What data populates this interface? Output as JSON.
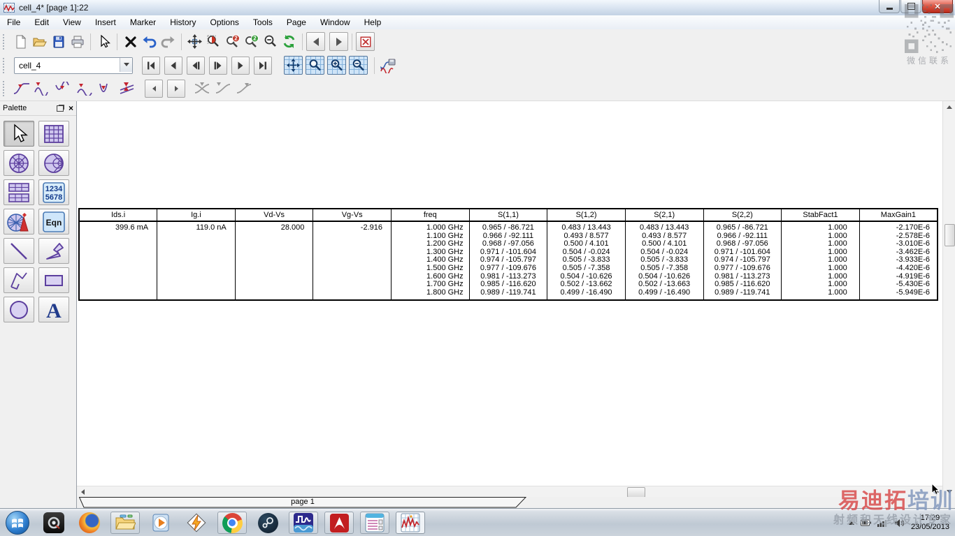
{
  "window": {
    "title": "cell_4* [page 1]:22"
  },
  "menu": {
    "items": [
      "File",
      "Edit",
      "View",
      "Insert",
      "Marker",
      "History",
      "Options",
      "Tools",
      "Page",
      "Window",
      "Help"
    ]
  },
  "toolbars": {
    "standard_icons": [
      "new-document",
      "open-project",
      "save",
      "print",
      "select-pointer",
      "delete",
      "undo",
      "redo",
      "pan-view",
      "zoom-area",
      "zoom-in-2x",
      "zoom-out-2x",
      "zoom-out",
      "refresh",
      "back",
      "forward",
      "close-window"
    ],
    "zoom_badge": "2",
    "page_nav": {
      "scope_value": "cell_4",
      "nav_icons": [
        "first-page",
        "previous-page",
        "step-back",
        "step-forward",
        "next-page",
        "last-page"
      ],
      "view_icons": [
        "view-all",
        "zoom-window",
        "zoom-in",
        "zoom-out"
      ],
      "extra_icons": [
        "add-trace"
      ]
    },
    "marker_icons": [
      "marker-on-trace",
      "marker-peak",
      "marker-valley",
      "marker-offset",
      "marker-search",
      "marker-limit-lines",
      "marker-previous",
      "marker-next",
      "marker-disabled-1",
      "marker-disabled-2",
      "marker-disabled-3"
    ]
  },
  "palette": {
    "title": "Palette",
    "buttons": [
      "pointer",
      "rectangular-graph",
      "polar-graph",
      "smith-chart",
      "tabular-graph",
      "numeric-table",
      "antenna-plot",
      "equation",
      "line",
      "polygon",
      "polyline",
      "rectangle",
      "circle",
      "text"
    ],
    "numeric_line1": "1234",
    "numeric_line2": "5678",
    "equation_label": "Eqn",
    "text_label": "A"
  },
  "table": {
    "columns": [
      {
        "header": "Ids.i",
        "align": "right",
        "values": [
          "399.6 mA"
        ]
      },
      {
        "header": "Ig.i",
        "align": "right",
        "values": [
          "119.0 nA"
        ]
      },
      {
        "header": "Vd-Vs",
        "align": "right",
        "values": [
          "28.000"
        ]
      },
      {
        "header": "Vg-Vs",
        "align": "right",
        "values": [
          "-2.916"
        ]
      },
      {
        "header": "freq",
        "align": "right",
        "values": [
          "1.000 GHz",
          "1.100 GHz",
          "1.200 GHz",
          "1.300 GHz",
          "1.400 GHz",
          "1.500 GHz",
          "1.600 GHz",
          "1.700 GHz",
          "1.800 GHz"
        ]
      },
      {
        "header": "S(1,1)",
        "align": "center",
        "values": [
          "0.965 / -86.721",
          "0.966 / -92.111",
          "0.968 / -97.056",
          "0.971 / -101.604",
          "0.974 / -105.797",
          "0.977 / -109.676",
          "0.981 / -113.273",
          "0.985 / -116.620",
          "0.989 / -119.741"
        ]
      },
      {
        "header": "S(1,2)",
        "align": "center",
        "values": [
          "0.483 / 13.443",
          "0.493 / 8.577",
          "0.500 / 4.101",
          "0.504 / -0.024",
          "0.505 / -3.833",
          "0.505 / -7.358",
          "0.504 / -10.626",
          "0.502 / -13.662",
          "0.499 / -16.490"
        ]
      },
      {
        "header": "S(2,1)",
        "align": "center",
        "values": [
          "0.483 / 13.443",
          "0.493 / 8.577",
          "0.500 / 4.101",
          "0.504 / -0.024",
          "0.505 / -3.833",
          "0.505 / -7.358",
          "0.504 / -10.626",
          "0.502 / -13.663",
          "0.499 / -16.490"
        ]
      },
      {
        "header": "S(2,2)",
        "align": "center",
        "values": [
          "0.965 / -86.721",
          "0.966 / -92.111",
          "0.968 / -97.056",
          "0.971 / -101.604",
          "0.974 / -105.797",
          "0.977 / -109.676",
          "0.981 / -113.273",
          "0.985 / -116.620",
          "0.989 / -119.741"
        ]
      },
      {
        "header": "StabFact1",
        "align": "right",
        "values": [
          "1.000",
          "1.000",
          "1.000",
          "1.000",
          "1.000",
          "1.000",
          "1.000",
          "1.000",
          "1.000"
        ]
      },
      {
        "header": "MaxGain1",
        "align": "right",
        "values": [
          "-2.170E-6",
          "-2.578E-6",
          "-3.010E-6",
          "-3.462E-6",
          "-3.933E-6",
          "-4.420E-6",
          "-4.919E-6",
          "-5.430E-6",
          "-5.949E-6"
        ]
      }
    ]
  },
  "page_tab": {
    "label": "page 1"
  },
  "taskbar": {
    "items": [
      "start-orb",
      "media-player-black",
      "firefox",
      "windows-explorer",
      "windows-media-player",
      "winamp",
      "chrome",
      "steam",
      "ads-main",
      "adobe-reader",
      "schematic-window",
      "data-display-window"
    ],
    "tray": {
      "time": "17:29",
      "date": "23/05/2013"
    }
  },
  "watermarks": {
    "qr_caption": "微信联系",
    "brand_red": "易迪拓",
    "brand_blue": "培训",
    "slogan": "射频和天线设计专家"
  },
  "colors": {
    "accent_purple": "#5c3f9e",
    "marker_red": "#c42430",
    "grid_blue": "#5b9bd5",
    "watermark_red": "#d84848",
    "watermark_blue": "#8096bc"
  }
}
